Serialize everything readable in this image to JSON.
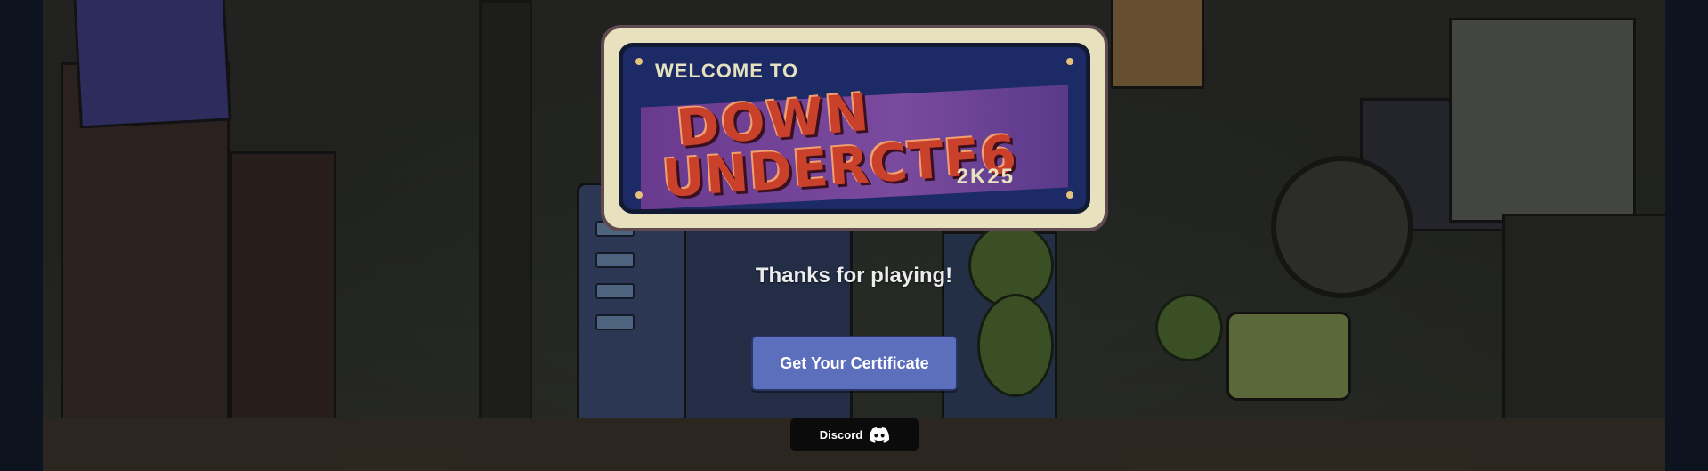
{
  "logo": {
    "welcome": "WELCOME TO",
    "line1": "DOWN",
    "line2": "UNDERCTF6",
    "year": "2K25"
  },
  "heading": "Thanks for playing!",
  "certificate_button": "Get Your Certificate",
  "discord_button": {
    "label": "Discord",
    "icon": "discord-icon"
  },
  "colors": {
    "button_bg": "#5b6fbd",
    "page_bg": "#0d1420"
  }
}
